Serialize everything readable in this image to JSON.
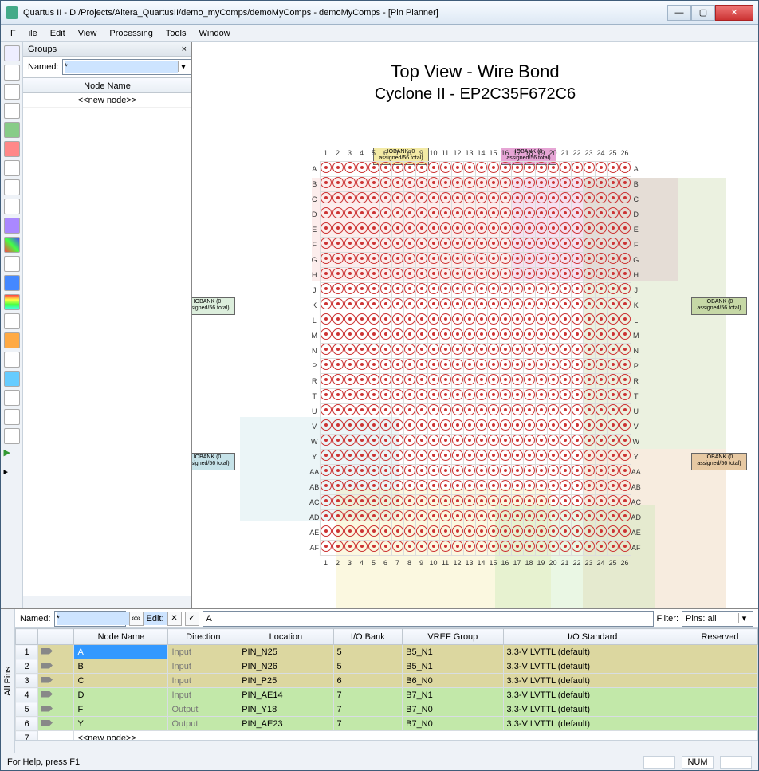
{
  "window": {
    "title": "Quartus II - D:/Projects/Altera_QuartusII/demo_myComps/demoMyComps - demoMyComps - [Pin Planner]",
    "min": "—",
    "max": "▢",
    "close": "✕"
  },
  "menu": {
    "file": "File",
    "edit": "Edit",
    "view": "View",
    "processing": "Processing",
    "tools": "Tools",
    "window": "Window"
  },
  "groups": {
    "title": "Groups",
    "close": "×",
    "named_label": "Named:",
    "named_value": "*",
    "nodename_header": "Node Name",
    "newnode": "<<new node>>"
  },
  "pinview": {
    "title1": "Top View - Wire Bond",
    "title2": "Cyclone II - EP2C35F672C6",
    "cols": [
      "1",
      "2",
      "3",
      "4",
      "5",
      "6",
      "7",
      "8",
      "9",
      "10",
      "11",
      "12",
      "13",
      "14",
      "15",
      "16",
      "17",
      "18",
      "19",
      "20",
      "21",
      "22",
      "23",
      "24",
      "25",
      "26"
    ],
    "rows": [
      "A",
      "B",
      "C",
      "D",
      "E",
      "F",
      "G",
      "H",
      "J",
      "K",
      "L",
      "M",
      "N",
      "P",
      "R",
      "T",
      "U",
      "V",
      "W",
      "Y",
      "AA",
      "AB",
      "AC",
      "AD",
      "AE",
      "AF"
    ],
    "bank_label_text": "IOBANK (0 assigned/56 total)"
  },
  "lower": {
    "tab": "All Pins",
    "named_label": "Named:",
    "named_value": "*",
    "edit_label": "Edit:",
    "edit_value": "A",
    "filter_label": "Filter:",
    "filter_value": "Pins: all",
    "headers": [
      "",
      "",
      "Node Name",
      "Direction",
      "Location",
      "I/O Bank",
      "VREF Group",
      "I/O Standard",
      "Reserved"
    ],
    "rows": [
      {
        "idx": "1",
        "name": "A",
        "dir": "Input",
        "loc": "PIN_N25",
        "bank": "5",
        "vref": "B5_N1",
        "std": "3.3-V LVTTL (default)",
        "res": "",
        "cls": "in sel"
      },
      {
        "idx": "2",
        "name": "B",
        "dir": "Input",
        "loc": "PIN_N26",
        "bank": "5",
        "vref": "B5_N1",
        "std": "3.3-V LVTTL (default)",
        "res": "",
        "cls": "in"
      },
      {
        "idx": "3",
        "name": "C",
        "dir": "Input",
        "loc": "PIN_P25",
        "bank": "6",
        "vref": "B6_N0",
        "std": "3.3-V LVTTL (default)",
        "res": "",
        "cls": "in"
      },
      {
        "idx": "4",
        "name": "D",
        "dir": "Input",
        "loc": "PIN_AE14",
        "bank": "7",
        "vref": "B7_N1",
        "std": "3.3-V LVTTL (default)",
        "res": "",
        "cls": "out"
      },
      {
        "idx": "5",
        "name": "F",
        "dir": "Output",
        "loc": "PIN_Y18",
        "bank": "7",
        "vref": "B7_N0",
        "std": "3.3-V LVTTL (default)",
        "res": "",
        "cls": "out"
      },
      {
        "idx": "6",
        "name": "Y",
        "dir": "Output",
        "loc": "PIN_AE23",
        "bank": "7",
        "vref": "B7_N0",
        "std": "3.3-V LVTTL (default)",
        "res": "",
        "cls": "out"
      }
    ],
    "newnode": "<<new node>>",
    "newidx": "7"
  },
  "status": {
    "help": "For Help, press F1",
    "num": "NUM"
  },
  "toolbar_icons": [
    "select",
    "pointer",
    "zoom",
    "hand",
    "route",
    "bank",
    "clock",
    "pll",
    "io",
    "group",
    "color",
    "diff",
    "layer",
    "legend",
    "map",
    "highlight",
    "find",
    "filter",
    "view3d",
    "report",
    "reset",
    "play",
    "next"
  ]
}
